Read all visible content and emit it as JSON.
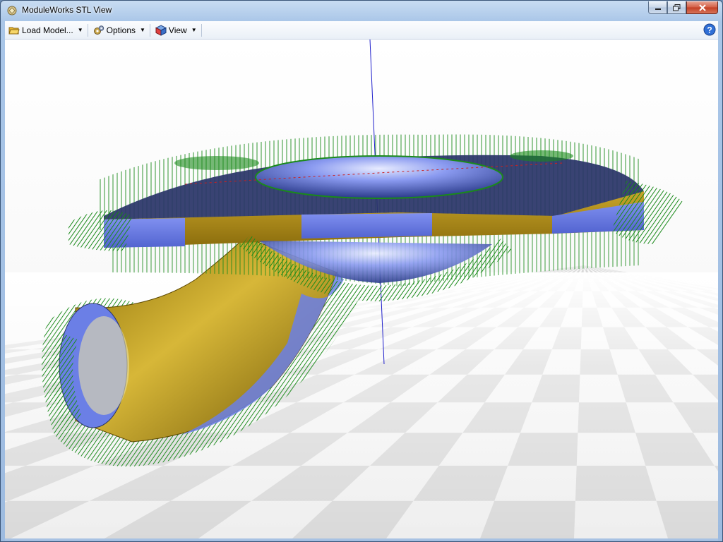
{
  "window": {
    "title": "ModuleWorks STL View"
  },
  "toolbar": {
    "load_label": "Load Model...",
    "options_label": "Options",
    "view_label": "View"
  },
  "icons": {
    "app": "module-icon",
    "load": "folder-open-icon",
    "options": "gears-icon",
    "view": "cube-icon",
    "help": "help-icon"
  },
  "colors": {
    "normals": "#1a8a1a",
    "surface_gold": "#b09018",
    "surface_blue": "#6b7fe6",
    "surface_dark": "#2a3568",
    "axis": "#2020cc"
  }
}
